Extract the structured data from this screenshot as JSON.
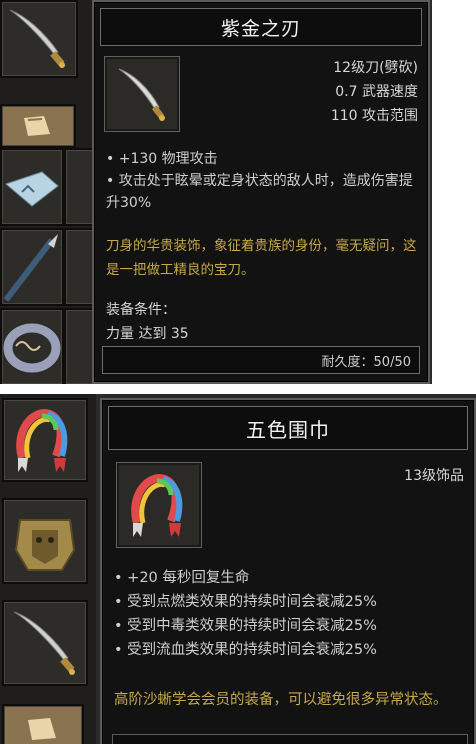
{
  "tooltips": [
    {
      "name": "紫金之刃",
      "stats": [
        "12级刀(劈砍)",
        "0.7  武器速度",
        "110  攻击范围"
      ],
      "bullets": [
        "+130 物理攻击",
        "攻击处于眩晕或定身状态的敌人时，造成伤害提升30%"
      ],
      "lore": "刀身的华贵装饰，象征着贵族的身份，毫无疑问，这是一把做工精良的宝刀。",
      "requirements_label": "装备条件：",
      "requirement": "力量 达到 35",
      "durability": "耐久度：50/50",
      "icon": "sabre-icon"
    },
    {
      "name": "五色围巾",
      "stats": [
        "13级饰品"
      ],
      "bullets": [
        "+20 每秒回复生命",
        "受到点燃类效果的持续时间会衰减25%",
        "受到中毒类效果的持续时间会衰减25%",
        "受到流血类效果的持续时间会衰减25%"
      ],
      "lore": "高阶沙蜥学会会员的装备，可以避免很多异常状态。",
      "icon": "rainbow-scarf-icon"
    }
  ],
  "colors": {
    "lore_text": "#c7a947",
    "tooltip_bg": "#121212",
    "frame": "#5b5b5b"
  }
}
